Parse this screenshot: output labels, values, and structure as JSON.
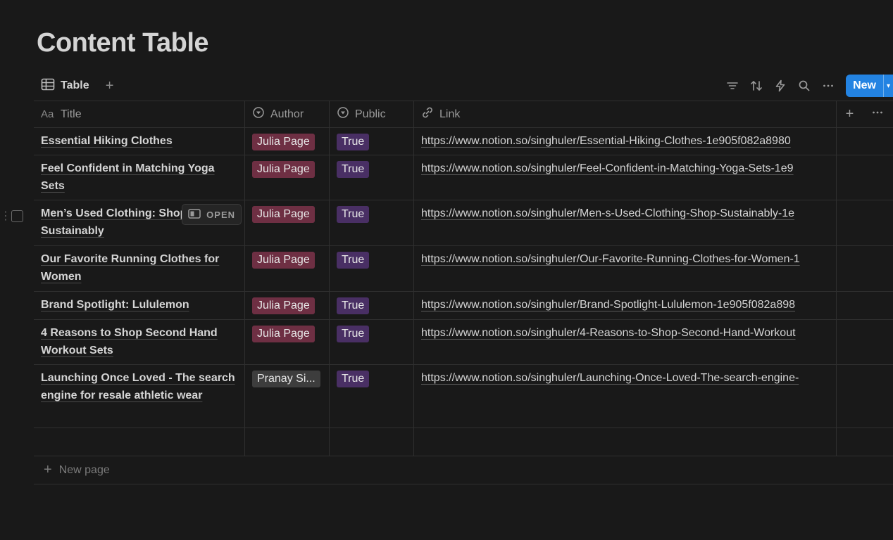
{
  "page": {
    "title": "Content Table"
  },
  "view": {
    "tab_label": "Table",
    "add_icon": "plus-icon",
    "new_button_label": "New",
    "actions": [
      "filter-icon",
      "sort-icon",
      "lightning-icon",
      "search-icon",
      "more-icon"
    ]
  },
  "table": {
    "columns": [
      {
        "label": "Title",
        "icon": "text-aa-icon"
      },
      {
        "label": "Author",
        "icon": "select-icon"
      },
      {
        "label": "Public",
        "icon": "select-icon"
      },
      {
        "label": "Link",
        "icon": "link-icon"
      }
    ],
    "rows": [
      {
        "title": "Essential Hiking Clothes",
        "author": "Julia Page",
        "public": "True",
        "link": "https://www.notion.so/singhuler/Essential-Hiking-Clothes-1e905f082a8980"
      },
      {
        "title": "Feel Confident in Matching Yoga Sets",
        "author": "Julia Page",
        "public": "True",
        "link": "https://www.notion.so/singhuler/Feel-Confident-in-Matching-Yoga-Sets-1e9"
      },
      {
        "title": "Men’s Used Clothing: Shop Sustainably",
        "author": "Julia Page",
        "public": "True",
        "link": "https://www.notion.so/singhuler/Men-s-Used-Clothing-Shop-Sustainably-1e"
      },
      {
        "title": "Our Favorite Running Clothes for Women",
        "author": "Julia Page",
        "public": "True",
        "link": "https://www.notion.so/singhuler/Our-Favorite-Running-Clothes-for-Women-1"
      },
      {
        "title": "Brand Spotlight: Lululemon",
        "author": "Julia Page",
        "public": "True",
        "link": "https://www.notion.so/singhuler/Brand-Spotlight-Lululemon-1e905f082a898"
      },
      {
        "title": "4 Reasons to Shop Second Hand Workout Sets",
        "author": "Julia Page",
        "public": "True",
        "link": "https://www.notion.so/singhuler/4-Reasons-to-Shop-Second-Hand-Workout"
      },
      {
        "title": "Launching Once Loved - The search engine for resale athletic wear",
        "author": "Pranay Si...",
        "public": "True",
        "link": "https://www.notion.so/singhuler/Launching-Once-Loved-The-search-engine-"
      }
    ],
    "open_label": "OPEN",
    "new_page_label": "New page"
  },
  "colors": {
    "background": "#191919",
    "accent": "#2383e2",
    "tag_red": "#6e2f43",
    "tag_purple": "#492f64",
    "tag_gray": "#3d3d3d"
  }
}
